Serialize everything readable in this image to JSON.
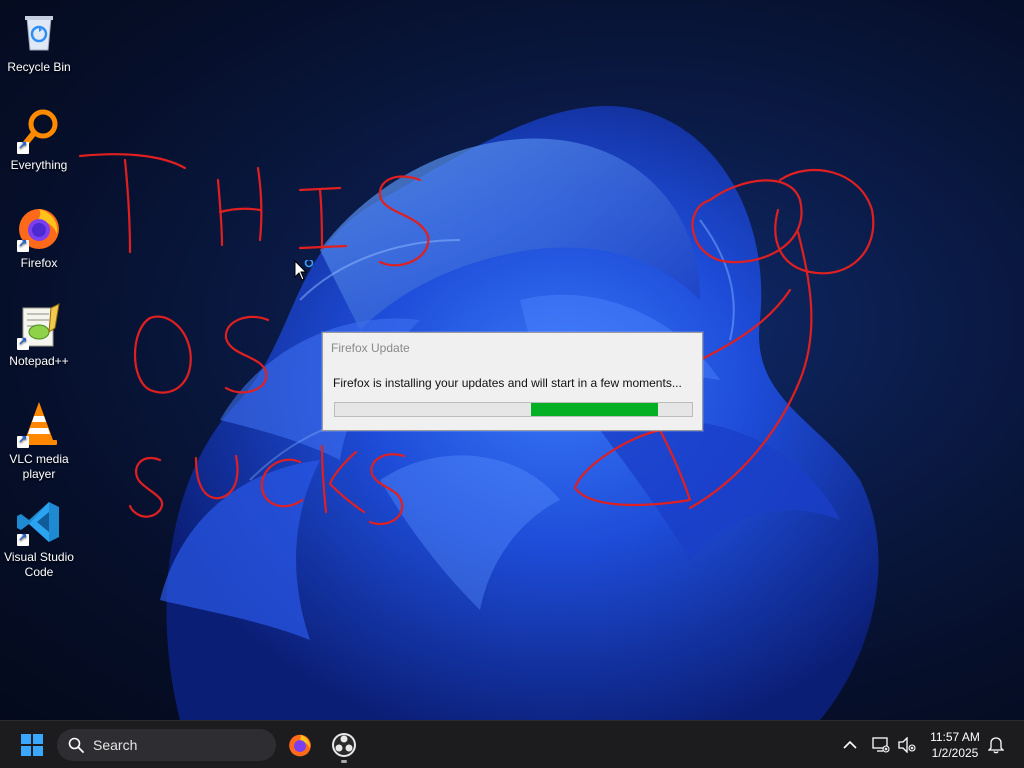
{
  "desktop": {
    "icons": [
      {
        "label": "Recycle Bin",
        "icon": "recycle-bin-icon"
      },
      {
        "label": "Everything",
        "icon": "everything-search-icon"
      },
      {
        "label": "Firefox",
        "icon": "firefox-icon"
      },
      {
        "label": "Notepad++",
        "icon": "notepad-plus-plus-icon"
      },
      {
        "label": "VLC media player",
        "icon": "vlc-icon"
      },
      {
        "label": "Visual Studio Code",
        "icon": "vscode-icon"
      }
    ],
    "scribble_color": "#e02020"
  },
  "dialog": {
    "title": "Firefox Update",
    "message": "Firefox is installing your updates and will start in a few moments...",
    "progress": {
      "start": 0.55,
      "end": 0.905,
      "color": "#06b025"
    }
  },
  "taskbar": {
    "start_icon": "windows-start-icon",
    "search_label": "Search",
    "pinned": [
      {
        "name": "firefox-taskbar-icon"
      },
      {
        "name": "obs-taskbar-icon",
        "running": true
      }
    ],
    "tray": {
      "time": "11:57 AM",
      "date": "1/2/2025",
      "icons": [
        "chevron-up-icon",
        "network-icon",
        "speaker-muted-icon",
        "notification-bell-icon"
      ]
    }
  }
}
